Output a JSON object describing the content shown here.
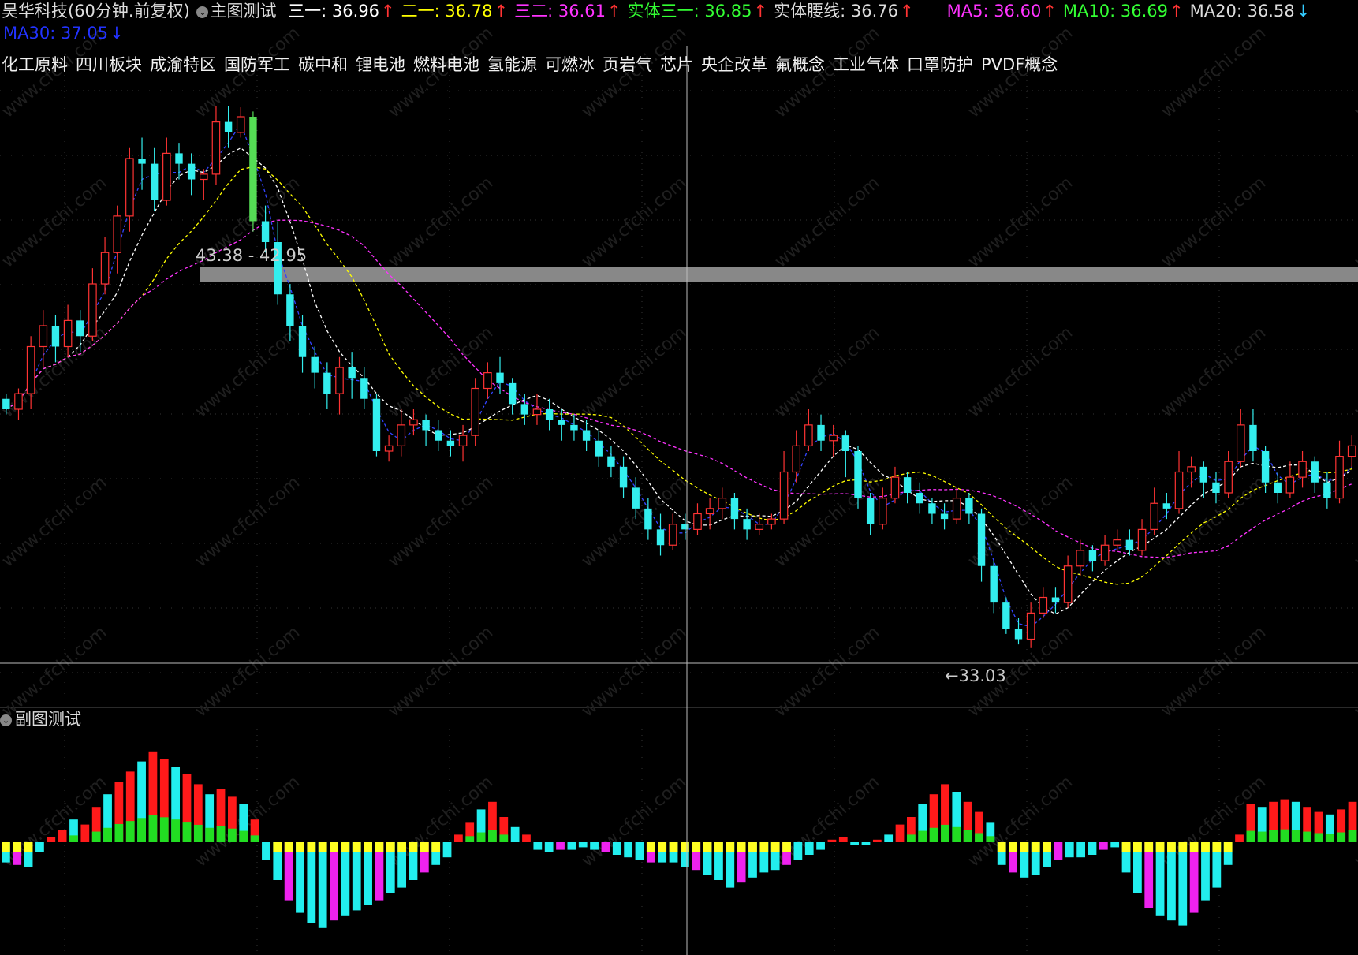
{
  "header": {
    "stock_name": "昊华科技(60分钟.前复权)",
    "main_indicator": "主图测试",
    "items": [
      {
        "label": "三一: 36.96",
        "color": "#ffffff",
        "arrow": "↑",
        "arrow_dir": "up"
      },
      {
        "label": "二一: 36.78",
        "color": "#ffff00",
        "arrow": "↑",
        "arrow_dir": "up"
      },
      {
        "label": "三二: 36.61",
        "color": "#ff33ff",
        "arrow": "↑",
        "arrow_dir": "up"
      },
      {
        "label": "实体三一: 36.85",
        "color": "#33ff33",
        "arrow": "↑",
        "arrow_dir": "up"
      },
      {
        "label": "实体腰线: 36.76",
        "color": "#dddddd",
        "arrow": "↑",
        "arrow_dir": "up"
      },
      {
        "label": "MA5: 36.60",
        "color": "#ff33ff",
        "arrow": "↑",
        "arrow_dir": "up"
      },
      {
        "label": "MA10: 36.69",
        "color": "#33ff33",
        "arrow": "↑",
        "arrow_dir": "up"
      },
      {
        "label": "MA20: 36.58",
        "color": "#dddddd",
        "arrow": "↓",
        "arrow_dir": "down"
      }
    ],
    "ma30": {
      "label": "MA30: 37.05",
      "color": "#2233ff",
      "arrow": "↓"
    }
  },
  "sectors": [
    "化工原料",
    "四川板块",
    "成渝特区",
    "国防军工",
    "碳中和",
    "锂电池",
    "燃料电池",
    "氢能源",
    "可燃冰",
    "页岩气",
    "芯片",
    "央企改革",
    "氟概念",
    "工业气体",
    "口罩防护",
    "PVDF概念"
  ],
  "sub_chart": {
    "title": "副图测试"
  },
  "annotations": {
    "high_label": "43.38 - 42.95",
    "low_label": "←33.03"
  },
  "colors": {
    "up_candle": "#ff3333",
    "down_candle": "#33eeee",
    "big_down": "#55dd55",
    "white_line": "#ffffff",
    "yellow_line": "#ffff00",
    "magenta_line": "#ff33ff",
    "blue_line": "#3344ff",
    "hist_red": "#ff1a1a",
    "hist_cyan": "#22eeee",
    "hist_green": "#22dd22",
    "hist_yellow": "#ffff22",
    "hist_magenta": "#ee22ee"
  },
  "chart_data": {
    "type": "candlestick",
    "ylim": [
      32.0,
      44.0
    ],
    "high_marker": 43.38,
    "low_marker": 33.03,
    "candles": [
      [
        37.8,
        37.6,
        37.9,
        37.5
      ],
      [
        37.6,
        37.9,
        38.0,
        37.4
      ],
      [
        37.9,
        38.8,
        39.0,
        37.6
      ],
      [
        38.8,
        39.2,
        39.5,
        38.4
      ],
      [
        39.2,
        38.8,
        39.4,
        38.5
      ],
      [
        38.8,
        39.3,
        39.6,
        38.6
      ],
      [
        39.3,
        39.0,
        39.5,
        38.7
      ],
      [
        39.0,
        40.0,
        40.3,
        38.9
      ],
      [
        40.0,
        40.6,
        40.9,
        39.8
      ],
      [
        40.6,
        41.3,
        41.5,
        40.2
      ],
      [
        41.3,
        42.4,
        42.6,
        41.0
      ],
      [
        42.4,
        42.3,
        42.8,
        41.8
      ],
      [
        42.3,
        41.6,
        42.6,
        41.4
      ],
      [
        41.6,
        42.5,
        42.8,
        41.5
      ],
      [
        42.5,
        42.3,
        42.7,
        42.0
      ],
      [
        42.3,
        42.0,
        42.5,
        41.7
      ],
      [
        42.0,
        42.1,
        42.2,
        41.6
      ],
      [
        42.1,
        43.1,
        43.4,
        41.9
      ],
      [
        43.1,
        42.9,
        43.4,
        42.6
      ],
      [
        42.9,
        43.2,
        43.38,
        42.8
      ],
      [
        43.2,
        41.2,
        43.3,
        41.0
      ],
      [
        41.2,
        40.8,
        41.5,
        40.6
      ],
      [
        40.8,
        39.8,
        41.2,
        39.6
      ],
      [
        39.8,
        39.2,
        40.0,
        38.9
      ],
      [
        39.2,
        38.6,
        39.4,
        38.3
      ],
      [
        38.6,
        38.3,
        38.8,
        38.0
      ],
      [
        38.3,
        37.9,
        38.5,
        37.6
      ],
      [
        37.9,
        38.4,
        38.6,
        37.5
      ],
      [
        38.4,
        38.2,
        38.7,
        37.8
      ],
      [
        38.2,
        37.8,
        38.4,
        37.6
      ],
      [
        37.8,
        36.8,
        37.9,
        36.7
      ],
      [
        36.8,
        36.9,
        37.1,
        36.6
      ],
      [
        36.9,
        37.3,
        37.6,
        36.7
      ],
      [
        37.3,
        37.4,
        37.6,
        37.1
      ],
      [
        37.4,
        37.2,
        37.5,
        36.9
      ],
      [
        37.2,
        37.0,
        37.4,
        36.8
      ],
      [
        37.0,
        36.9,
        37.2,
        36.7
      ],
      [
        36.9,
        37.1,
        37.3,
        36.6
      ],
      [
        37.1,
        38.0,
        38.2,
        36.9
      ],
      [
        38.0,
        38.3,
        38.5,
        37.8
      ],
      [
        38.3,
        38.1,
        38.6,
        37.9
      ],
      [
        38.1,
        37.7,
        38.2,
        37.5
      ],
      [
        37.7,
        37.5,
        37.9,
        37.3
      ],
      [
        37.5,
        37.6,
        37.9,
        37.3
      ],
      [
        37.6,
        37.4,
        37.8,
        37.2
      ],
      [
        37.4,
        37.3,
        37.6,
        37.0
      ],
      [
        37.3,
        37.2,
        37.5,
        37.0
      ],
      [
        37.2,
        37.0,
        37.4,
        36.8
      ],
      [
        37.0,
        36.7,
        37.2,
        36.5
      ],
      [
        36.7,
        36.5,
        36.9,
        36.3
      ],
      [
        36.5,
        36.1,
        36.7,
        35.9
      ],
      [
        36.1,
        35.7,
        36.3,
        35.5
      ],
      [
        35.7,
        35.3,
        35.9,
        35.1
      ],
      [
        35.3,
        35.0,
        35.6,
        34.8
      ],
      [
        35.0,
        35.4,
        35.6,
        34.9
      ],
      [
        35.4,
        35.3,
        35.6,
        35.1
      ],
      [
        35.3,
        35.6,
        35.8,
        35.2
      ],
      [
        35.6,
        35.7,
        35.9,
        35.3
      ],
      [
        35.7,
        35.9,
        36.1,
        35.5
      ],
      [
        35.9,
        35.5,
        36.0,
        35.3
      ],
      [
        35.5,
        35.3,
        35.7,
        35.1
      ],
      [
        35.3,
        35.4,
        35.6,
        35.2
      ],
      [
        35.4,
        35.5,
        35.6,
        35.3
      ],
      [
        35.5,
        36.4,
        36.8,
        35.4
      ],
      [
        36.4,
        36.9,
        37.2,
        36.2
      ],
      [
        36.9,
        37.3,
        37.6,
        36.8
      ],
      [
        37.3,
        37.0,
        37.5,
        36.8
      ],
      [
        37.0,
        37.1,
        37.3,
        36.7
      ],
      [
        37.1,
        36.8,
        37.2,
        36.3
      ],
      [
        36.8,
        35.9,
        36.9,
        35.7
      ],
      [
        35.9,
        35.4,
        36.0,
        35.2
      ],
      [
        35.4,
        35.9,
        36.1,
        35.3
      ],
      [
        35.9,
        36.3,
        36.5,
        35.8
      ],
      [
        36.3,
        36.0,
        36.4,
        35.8
      ],
      [
        36.0,
        35.8,
        36.2,
        35.6
      ],
      [
        35.8,
        35.6,
        35.9,
        35.4
      ],
      [
        35.6,
        35.5,
        35.8,
        35.3
      ],
      [
        35.5,
        35.9,
        36.1,
        35.4
      ],
      [
        35.9,
        35.6,
        36.0,
        35.4
      ],
      [
        35.6,
        34.6,
        35.7,
        34.3
      ],
      [
        34.6,
        33.9,
        34.7,
        33.7
      ],
      [
        33.9,
        33.4,
        34.0,
        33.3
      ],
      [
        33.4,
        33.2,
        33.6,
        33.1
      ],
      [
        33.2,
        33.7,
        33.9,
        33.03
      ],
      [
        33.7,
        34.0,
        34.2,
        33.6
      ],
      [
        34.0,
        33.9,
        34.2,
        33.7
      ],
      [
        33.9,
        34.6,
        34.8,
        33.8
      ],
      [
        34.6,
        34.9,
        35.1,
        34.4
      ],
      [
        34.9,
        34.7,
        35.0,
        34.5
      ],
      [
        34.7,
        35.0,
        35.2,
        34.6
      ],
      [
        35.0,
        35.1,
        35.3,
        34.9
      ],
      [
        35.1,
        34.9,
        35.3,
        34.8
      ],
      [
        34.9,
        35.3,
        35.5,
        34.8
      ],
      [
        35.3,
        35.8,
        36.1,
        35.2
      ],
      [
        35.8,
        35.7,
        36.0,
        35.5
      ],
      [
        35.7,
        36.4,
        36.8,
        35.6
      ],
      [
        36.4,
        36.5,
        36.7,
        36.1
      ],
      [
        36.5,
        36.2,
        36.6,
        35.9
      ],
      [
        36.2,
        36.0,
        36.4,
        35.8
      ],
      [
        36.0,
        36.6,
        36.8,
        35.9
      ],
      [
        36.6,
        37.3,
        37.6,
        36.5
      ],
      [
        37.3,
        36.8,
        37.6,
        36.6
      ],
      [
        36.8,
        36.2,
        36.9,
        36.0
      ],
      [
        36.2,
        36.0,
        36.4,
        35.8
      ],
      [
        36.0,
        36.3,
        36.6,
        35.9
      ],
      [
        36.3,
        36.6,
        36.8,
        36.1
      ],
      [
        36.6,
        36.2,
        36.7,
        36.0
      ],
      [
        36.2,
        35.9,
        36.4,
        35.7
      ],
      [
        35.9,
        36.7,
        37.0,
        35.8
      ],
      [
        36.7,
        36.9,
        37.1,
        36.5
      ]
    ],
    "histogram": [
      -0.8,
      -0.9,
      -1.0,
      -0.4,
      0.2,
      0.5,
      0.9,
      0.7,
      1.4,
      1.9,
      2.4,
      2.8,
      3.2,
      3.6,
      3.3,
      3.0,
      2.7,
      2.3,
      1.9,
      2.1,
      1.8,
      1.5,
      0.9,
      -0.7,
      -1.5,
      -2.3,
      -2.8,
      -3.2,
      -3.4,
      -3.1,
      -2.9,
      -2.7,
      -2.5,
      -2.3,
      -2.0,
      -1.8,
      -1.5,
      -1.2,
      -0.9,
      -0.6,
      0.3,
      0.8,
      1.3,
      1.6,
      1.0,
      0.6,
      0.3,
      -0.3,
      -0.4,
      -0.3,
      -0.3,
      -0.2,
      -0.3,
      -0.4,
      -0.5,
      -0.6,
      -0.7,
      -0.8,
      -0.8,
      -0.8,
      -1.0,
      -1.1,
      -1.3,
      -1.5,
      -1.8,
      -1.6,
      -1.4,
      -1.2,
      -1.1,
      -0.9,
      -0.7,
      -0.5,
      -0.3,
      0.1,
      0.2,
      -0.1,
      -0.1,
      0.1,
      0.3,
      0.7,
      1.0,
      1.5,
      1.9,
      2.3,
      2.0,
      1.6,
      1.2,
      0.8,
      -0.9,
      -1.2,
      -1.4,
      -1.3,
      -1.0,
      -0.7,
      -0.6,
      -0.6,
      -0.5,
      -0.3,
      -0.2,
      -1.2,
      -2.0,
      -2.6,
      -2.9,
      -3.1,
      -3.3,
      -2.8,
      -2.3,
      -1.8,
      -0.9,
      0.3,
      1.5,
      1.4,
      1.6,
      1.7,
      1.6,
      1.4,
      1.2,
      1.1,
      1.3,
      1.6
    ]
  }
}
